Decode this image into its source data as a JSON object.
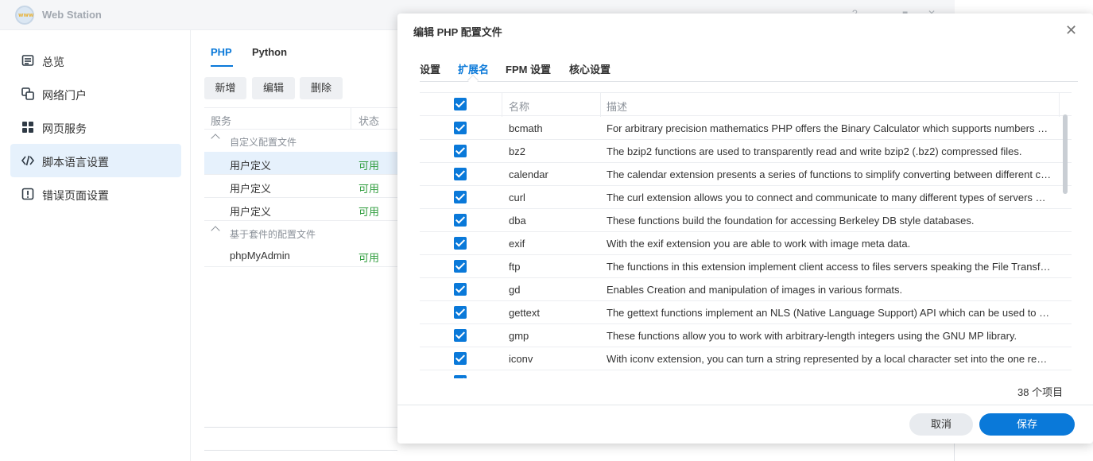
{
  "app": {
    "title": "Web Station"
  },
  "sidebar": {
    "items": [
      {
        "label": "总览",
        "icon": "overview-icon"
      },
      {
        "label": "网络门户",
        "icon": "portal-icon"
      },
      {
        "label": "网页服务",
        "icon": "web-service-icon"
      },
      {
        "label": "脚本语言设置",
        "icon": "code-icon",
        "active": true
      },
      {
        "label": "错误页面设置",
        "icon": "error-page-icon"
      }
    ]
  },
  "main": {
    "tabs": [
      {
        "label": "PHP",
        "active": true
      },
      {
        "label": "Python"
      }
    ],
    "toolbar": {
      "add": "新增",
      "edit": "编辑",
      "delete": "删除"
    },
    "columns": {
      "service": "服务",
      "status": "状态"
    },
    "groups": [
      {
        "label": "自定义配置文件"
      },
      {
        "label": "基于套件的配置文件"
      }
    ],
    "rows": [
      {
        "name": "用户定义",
        "status": "可用"
      },
      {
        "name": "用户定义",
        "status": "可用"
      },
      {
        "name": "用户定义",
        "status": "可用"
      },
      {
        "name": "phpMyAdmin",
        "status": "可用"
      }
    ]
  },
  "dialog": {
    "title": "编辑 PHP 配置文件",
    "tabs": [
      {
        "label": "设置"
      },
      {
        "label": "扩展名",
        "active": true
      },
      {
        "label": "FPM 设置"
      },
      {
        "label": "核心设置"
      }
    ],
    "columns": {
      "name": "名称",
      "desc": "描述"
    },
    "extensions": [
      {
        "name": "bcmath",
        "desc": "For arbitrary precision mathematics PHP offers the Binary Calculator which supports numbers of any size and precision"
      },
      {
        "name": "bz2",
        "desc": "The bzip2 functions are used to transparently read and write bzip2 (.bz2) compressed files."
      },
      {
        "name": "calendar",
        "desc": "The calendar extension presents a series of functions to simplify converting between different calendar formats."
      },
      {
        "name": "curl",
        "desc": "The curl extension allows you to connect and communicate to many different types of servers with many different types of protocols."
      },
      {
        "name": "dba",
        "desc": "These functions build the foundation for accessing Berkeley DB style databases."
      },
      {
        "name": "exif",
        "desc": "With the exif extension you are able to work with image meta data."
      },
      {
        "name": "ftp",
        "desc": "The functions in this extension implement client access to files servers speaking the File Transfer Protocol."
      },
      {
        "name": "gd",
        "desc": "Enables Creation and manipulation of images in various formats."
      },
      {
        "name": "gettext",
        "desc": "The gettext functions implement an NLS (Native Language Support) API which can be used to internationalize your PHP applications."
      },
      {
        "name": "gmp",
        "desc": "These functions allow you to work with arbitrary-length integers using the GNU MP library."
      },
      {
        "name": "iconv",
        "desc": "With iconv extension, you can turn a string represented by a local character set into the one represented by another character set."
      }
    ],
    "count": "38 个项目",
    "buttons": {
      "cancel": "取消",
      "save": "保存"
    }
  },
  "colors": {
    "accent": "#0a79d9",
    "status_ok": "#2e9c3c",
    "active_bg": "#e6f1fc"
  }
}
